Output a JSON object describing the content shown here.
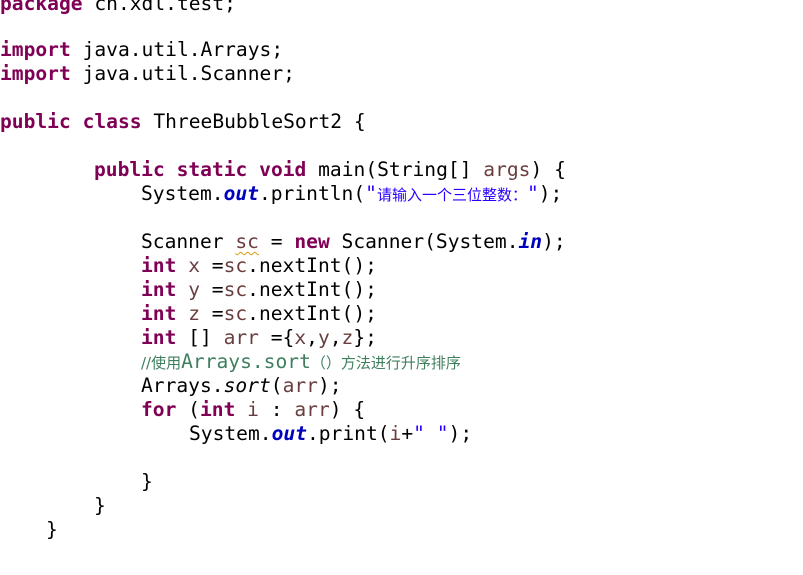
{
  "code": {
    "package_kw": "package",
    "package_name": " cn.xdl.test;",
    "import_kw": "import",
    "import1": " java.util.Arrays;",
    "import2": " java.util.Scanner;",
    "public_kw": "public",
    "class_kw": "class",
    "class_name": " ThreeBubbleSort2 {",
    "static_kw": "static",
    "void_kw": "void",
    "main_sig_a": " main(String[] ",
    "main_args": "args",
    "main_sig_b": ") {",
    "system": "System.",
    "out": "out",
    "println_open": ".println(",
    "prompt_q1": "\"",
    "prompt_text": "请输入一个三位整数：",
    "prompt_q2": "\"",
    "println_close": ");",
    "scanner_type": "Scanner ",
    "sc_var": "sc",
    "assign_eq": " = ",
    "new_kw": "new",
    "scanner_ctor": " Scanner(System.",
    "in_field": "in",
    "ctor_close": ");",
    "int_kw": "int",
    "x_var": "x",
    "y_var": "y",
    "z_var": "z",
    "sc_call": "sc",
    "next_int": ".nextInt();",
    "assign_tight": " =",
    "arr_decl_a": " [] ",
    "arr_var": "arr",
    "arr_init_a": " ={",
    "comma": ",",
    "arr_init_b": "};",
    "comment_a": "//使用",
    "comment_b": "Arrays.sort",
    "comment_c": "（）方法进行升序排序",
    "arrays": "Arrays.",
    "sort": "sort",
    "sort_open": "(",
    "sort_close": ");",
    "for_kw": "for",
    "for_open": " (",
    "i_var": "i",
    "colon": " : ",
    "for_close": ") {",
    "print_call": ".print(",
    "plus": "+",
    "space_str": "\" \"",
    "brace_close": "}"
  }
}
